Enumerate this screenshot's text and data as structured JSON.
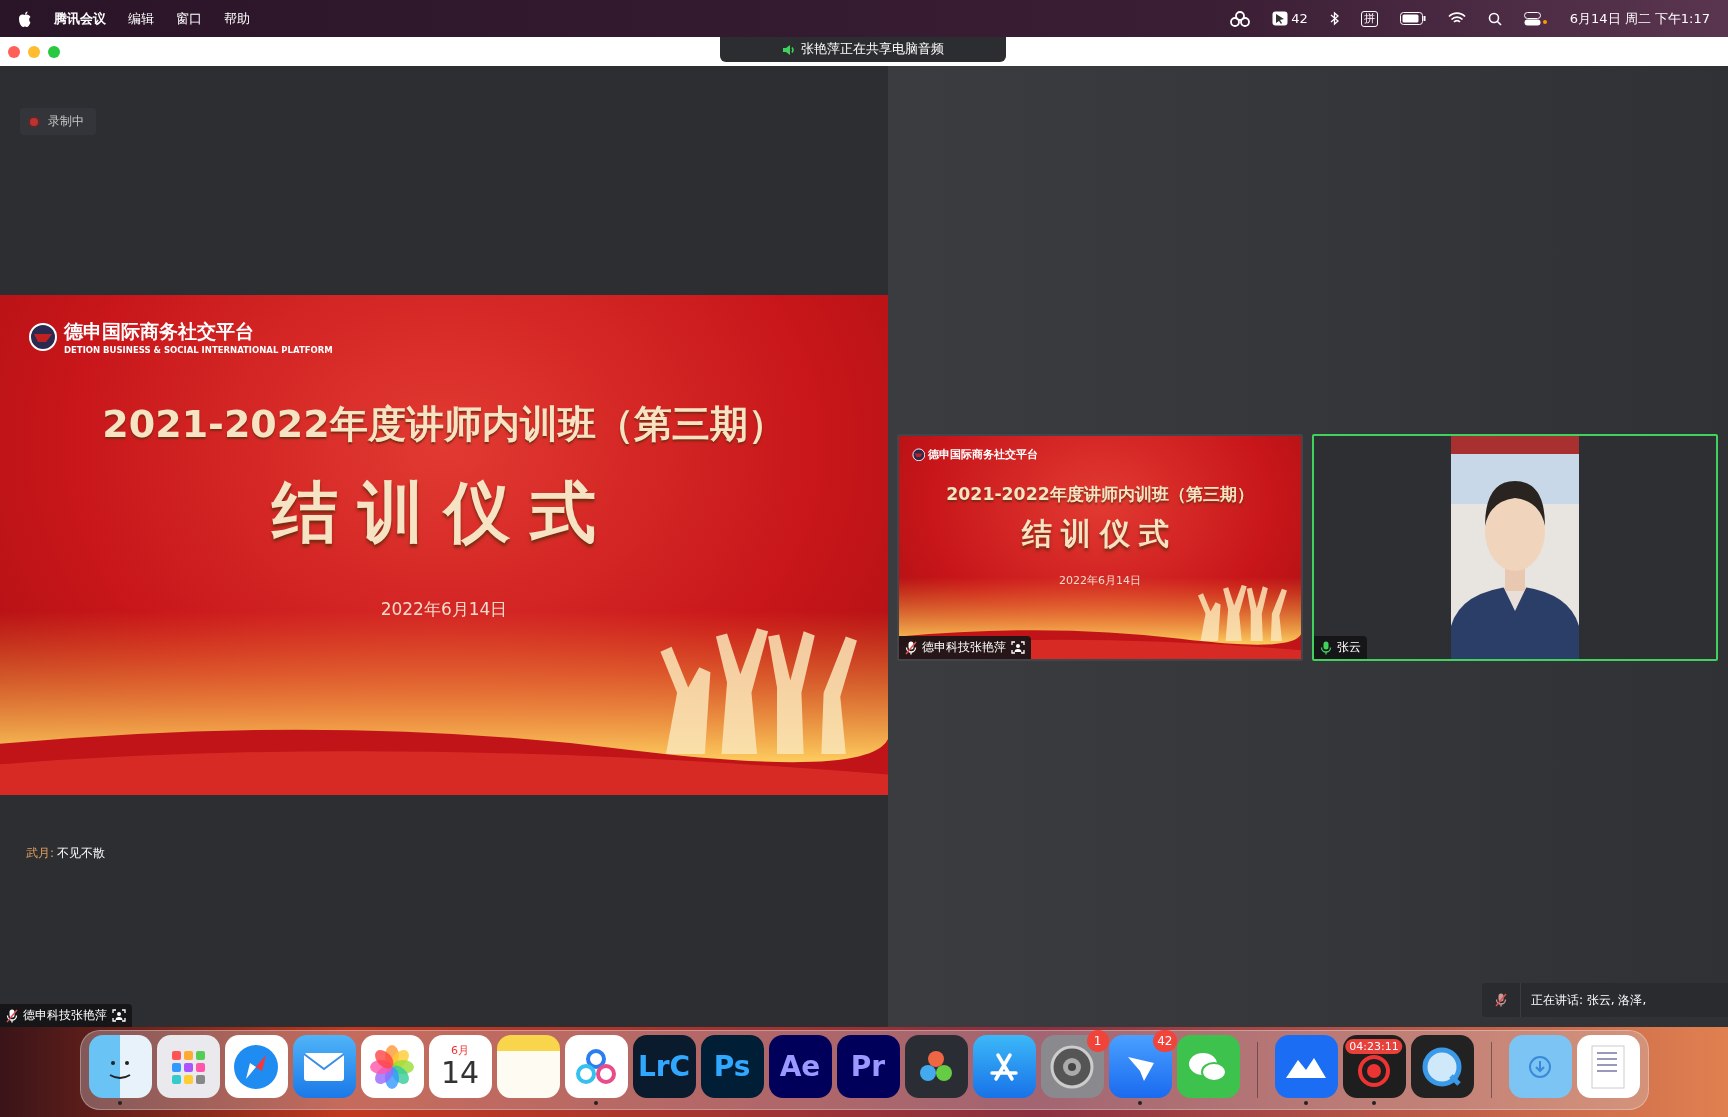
{
  "menu_bar": {
    "app_menus": [
      "腾讯会议",
      "编辑",
      "窗口",
      "帮助"
    ],
    "notification_count": "42",
    "input_method": "拼",
    "clock": "6月14日 周二 下午1:17"
  },
  "share_banner": {
    "text": "张艳萍正在共享电脑音频"
  },
  "recording": {
    "label": "录制中"
  },
  "main_slide": {
    "org_name": "德申国际商务社交平台",
    "org_subtitle": "DETION BUSINESS & SOCIAL INTERNATIONAL PLATFORM",
    "title": "2021-2022年度讲师内训班（第三期）",
    "subtitle": "结训仪式",
    "date": "2022年6月14日"
  },
  "chat": [
    {
      "sender": "武月:",
      "text": "不见不散"
    }
  ],
  "main_name_tag": {
    "name": "德申科技张艳萍",
    "muted": true
  },
  "tiles": [
    {
      "kind": "slide",
      "name": "德申科技张艳萍",
      "muted": true,
      "active_speaker": false,
      "slide": {
        "org_name": "德申国际商务社交平台",
        "title": "2021-2022年度讲师内训班（第三期）",
        "subtitle": "结训仪式",
        "date": "2022年6月14日"
      }
    },
    {
      "kind": "camera",
      "name": "张云",
      "muted": false,
      "active_speaker": true
    }
  ],
  "speaking_bar": {
    "text": "正在讲话: 张云, 洛泽,",
    "muted": true
  },
  "dock": [
    {
      "kind": "finder",
      "running": true
    },
    {
      "kind": "launchpad",
      "running": false
    },
    {
      "kind": "safari",
      "running": false
    },
    {
      "kind": "mail",
      "running": false
    },
    {
      "kind": "photos",
      "running": false
    },
    {
      "kind": "calendar",
      "month": "6月",
      "day": "14",
      "running": false
    },
    {
      "kind": "notes",
      "running": false
    },
    {
      "kind": "cloud",
      "running": true
    },
    {
      "kind": "lrc",
      "label": "LrC",
      "running": false
    },
    {
      "kind": "ps",
      "label": "Ps",
      "running": false
    },
    {
      "kind": "ae",
      "label": "Ae",
      "running": false
    },
    {
      "kind": "pr",
      "label": "Pr",
      "running": false
    },
    {
      "kind": "davinci",
      "running": false
    },
    {
      "kind": "appstore",
      "running": false
    },
    {
      "kind": "settings",
      "badge": "1",
      "running": false
    },
    {
      "kind": "feishu",
      "badge": "42",
      "running": true
    },
    {
      "kind": "wechat",
      "running": false
    },
    {
      "kind": "divider"
    },
    {
      "kind": "lanhu",
      "running": true
    },
    {
      "kind": "recorder",
      "timer": "04:23:11",
      "running": true
    },
    {
      "kind": "quicktime",
      "running": false
    },
    {
      "kind": "divider"
    },
    {
      "kind": "downloads",
      "running": false
    },
    {
      "kind": "document",
      "running": false
    }
  ]
}
